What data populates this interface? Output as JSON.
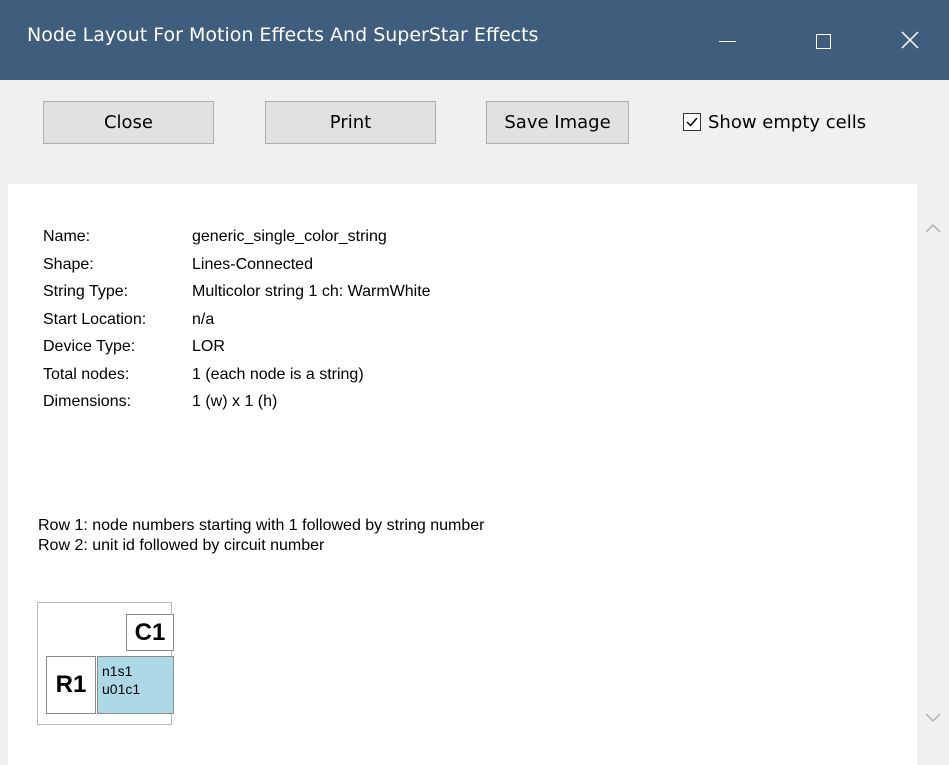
{
  "window": {
    "title": "Node Layout For Motion Effects And SuperStar Effects",
    "controls": {
      "minimize_icon": "minimize-icon",
      "maximize_icon": "maximize-icon",
      "close_icon": "close-icon"
    },
    "titlebar_color": "#3f5d7c"
  },
  "toolbar": {
    "close_label": "Close",
    "print_label": "Print",
    "save_image_label": "Save Image",
    "show_empty_cells": {
      "label": "Show empty cells",
      "checked": true
    }
  },
  "info": {
    "rows": [
      {
        "key": "Name:",
        "value": "generic_single_color_string"
      },
      {
        "key": "Shape:",
        "value": "Lines-Connected"
      },
      {
        "key": "String Type:",
        "value": "Multicolor string 1 ch: WarmWhite"
      },
      {
        "key": "Start Location:",
        "value": "n/a"
      },
      {
        "key": "Device Type:",
        "value": "LOR"
      },
      {
        "key": "Total nodes:",
        "value": "1 (each node is a string)"
      },
      {
        "key": "Dimensions:",
        "value": "1 (w) x 1 (h)"
      }
    ]
  },
  "legend": {
    "line1": "Row 1: node numbers starting with 1 followed by string number",
    "line2": "Row 2: unit id followed by circuit number"
  },
  "grid": {
    "column_header": "C1",
    "row_header": "R1",
    "cell": {
      "line1": "n1s1",
      "line2": "u01c1",
      "color": "#add8e6"
    }
  }
}
